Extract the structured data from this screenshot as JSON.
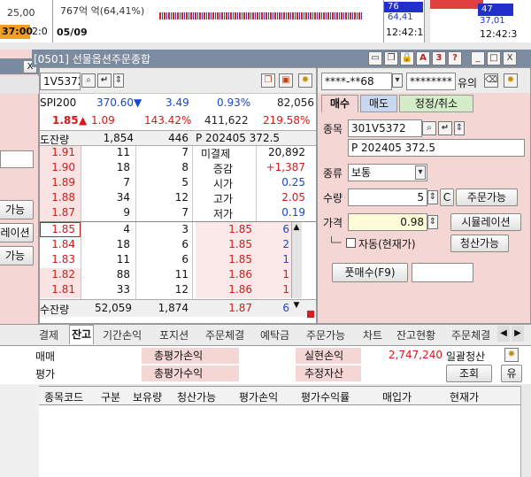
{
  "top": {
    "price_left": "25,00",
    "time_orange": "37:00",
    "time_orange_suffix": "2:0",
    "chart_text": "767억 억(64,41%)",
    "date": "05/09",
    "time_mid": "12:42:1",
    "mid_val1": "76",
    "mid_val2": "64,41",
    "right_val1": "47",
    "right_val2": "37,01",
    "time_right": "12:42:3"
  },
  "window": {
    "title": "[0501] 선물옵션주문종합",
    "min": "_",
    "max": "□",
    "close": "X",
    "help": "?",
    "icon_a": "A",
    "icon_3": "3"
  },
  "left_panel": {
    "close": "X",
    "items": [
      "가능",
      "레이션",
      "가능"
    ]
  },
  "header": {
    "code": "1V5372",
    "kospi_label": "SPI200",
    "kospi_value": "370.60",
    "kospi_change": "3.49",
    "kospi_rate": "0.93%",
    "kospi_volume": "82,056",
    "opt_price": "1.85",
    "opt_change": "1.09",
    "opt_rate": "143.42%",
    "opt_volume": "411,622",
    "opt_rate2": "219.58%"
  },
  "orderbook": {
    "header_label": "도잔량",
    "header_qty": "1,854",
    "header_cnt": "446",
    "info_label": "P 202405 372.5",
    "asks": [
      {
        "price": "1.91",
        "qty": "11",
        "cnt": "7"
      },
      {
        "price": "1.90",
        "qty": "18",
        "cnt": "8"
      },
      {
        "price": "1.89",
        "qty": "7",
        "cnt": "5"
      },
      {
        "price": "1.88",
        "qty": "34",
        "cnt": "12"
      },
      {
        "price": "1.87",
        "qty": "9",
        "cnt": "7"
      }
    ],
    "bids": [
      {
        "price": "1.85",
        "qty": "4",
        "cnt": "3"
      },
      {
        "price": "1.84",
        "qty": "18",
        "cnt": "6"
      },
      {
        "price": "1.83",
        "qty": "11",
        "cnt": "6"
      },
      {
        "price": "1.82",
        "qty": "88",
        "cnt": "11"
      },
      {
        "price": "1.81",
        "qty": "33",
        "cnt": "12"
      }
    ],
    "footer_label": "수잔량",
    "footer_qty": "52,059",
    "footer_cnt": "1,874",
    "footer_price": "1.87",
    "footer_count": "6",
    "info": [
      {
        "label": "미결제",
        "value": "20,892"
      },
      {
        "label": "증감",
        "value": "+1,387"
      },
      {
        "label": "시가",
        "value": "0.25"
      },
      {
        "label": "고가",
        "value": "2.05"
      },
      {
        "label": "저가",
        "value": "0.19"
      }
    ],
    "ticks": [
      {
        "price": "1.85",
        "count": "6"
      },
      {
        "price": "1.85",
        "count": "2"
      },
      {
        "price": "1.85",
        "count": "1"
      },
      {
        "price": "1.86",
        "count": "1"
      },
      {
        "price": "1.86",
        "count": "1"
      }
    ]
  },
  "order": {
    "account": "****-**68",
    "password": "********",
    "yuui": "유의",
    "tabs": [
      "매수",
      "매도",
      "정정/취소"
    ],
    "code_label": "종목",
    "code_value": "301V5372",
    "name": "P 202405 372.5",
    "type_label": "종류",
    "type_value": "보통",
    "qty_label": "수량",
    "qty_value": "5",
    "c_btn": "C",
    "orderable_btn": "주문가능",
    "price_label": "가격",
    "price_value": "0.98",
    "sim_btn": "시뮬레이션",
    "auto_label": "자동(현재가)",
    "liq_btn": "청산가능",
    "buy_btn": "풋매수(F9)"
  },
  "bottom": {
    "tabs": [
      "결제",
      "잔고",
      "기간손익",
      "포지션",
      "주문체결",
      "예탁금",
      "주문가능",
      "차트",
      "잔고현황",
      "주문체결"
    ],
    "row1": {
      "left": "매매",
      "total_eval_pl": "총평가손익",
      "realized_pl": "실현손익",
      "realized_value": "2,747,240",
      "liquidate": "일괄청산"
    },
    "row2": {
      "left": "평가",
      "total_eval_rate": "총평가수익",
      "est_asset": "추정자산",
      "query": "조회",
      "yu": "유"
    },
    "columns": [
      "종목코드",
      "구분",
      "보유량",
      "청산가능",
      "평가손익",
      "평가수익률",
      "매입가",
      "현재가"
    ]
  }
}
